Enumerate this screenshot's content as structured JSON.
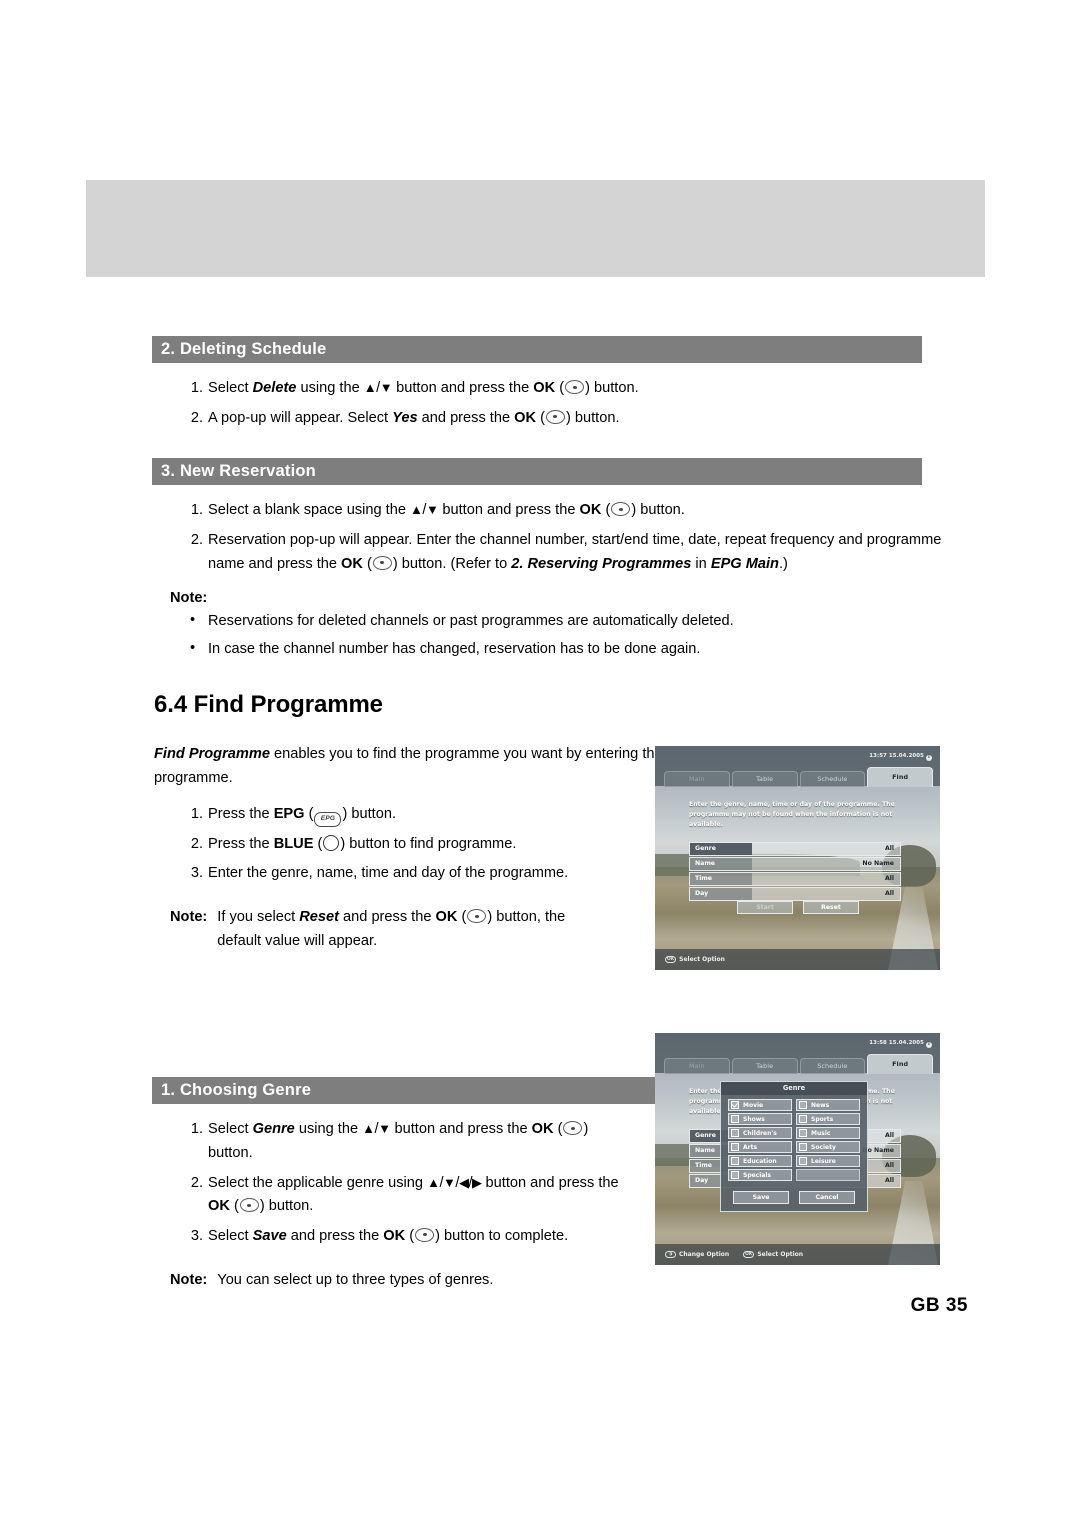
{
  "document": {
    "page_number_label": "GB 35"
  },
  "sections": [
    {
      "id": "deleting-schedule",
      "title": "2. Deleting Schedule",
      "steps": [
        {
          "num": "1.",
          "parts": [
            {
              "t": "Select ",
              "s": "plain"
            },
            {
              "t": "Delete",
              "s": "bi"
            },
            {
              "t": " using the ",
              "s": "plain"
            },
            {
              "t": "arrows-ud",
              "s": "glyph"
            },
            {
              "t": " button and press the ",
              "s": "plain"
            },
            {
              "t": "OK",
              "s": "bold"
            },
            {
              "t": " (",
              "s": "plain"
            },
            {
              "t": "ok-button",
              "s": "glyph"
            },
            {
              "t": ") button.",
              "s": "plain"
            }
          ]
        },
        {
          "num": "2.",
          "parts": [
            {
              "t": "A pop-up will appear. Select ",
              "s": "plain"
            },
            {
              "t": "Yes",
              "s": "bi"
            },
            {
              "t": " and press the ",
              "s": "plain"
            },
            {
              "t": "OK",
              "s": "bold"
            },
            {
              "t": " (",
              "s": "plain"
            },
            {
              "t": "ok-button",
              "s": "glyph"
            },
            {
              "t": ") button.",
              "s": "plain"
            }
          ]
        }
      ]
    },
    {
      "id": "new-reservation",
      "title": "3. New Reservation",
      "steps": [
        {
          "num": "1.",
          "parts": [
            {
              "t": "Select a blank space using the ",
              "s": "plain"
            },
            {
              "t": "arrows-ud",
              "s": "glyph"
            },
            {
              "t": " button and press the ",
              "s": "plain"
            },
            {
              "t": "OK",
              "s": "bold"
            },
            {
              "t": " (",
              "s": "plain"
            },
            {
              "t": "ok-button",
              "s": "glyph"
            },
            {
              "t": ") button.",
              "s": "plain"
            }
          ]
        },
        {
          "num": "2.",
          "parts": [
            {
              "t": "Reservation pop-up will appear. Enter the channel number, start/end time, date, repeat frequency and programme name and press the ",
              "s": "plain"
            },
            {
              "t": "OK",
              "s": "bold"
            },
            {
              "t": " (",
              "s": "plain"
            },
            {
              "t": "ok-button",
              "s": "glyph"
            },
            {
              "t": ") button. (Refer to ",
              "s": "plain"
            },
            {
              "t": "2. Reserving Programmes",
              "s": "bi"
            },
            {
              "t": " in ",
              "s": "plain"
            },
            {
              "t": "EPG Main",
              "s": "bi"
            },
            {
              "t": ".)",
              "s": "plain"
            }
          ]
        }
      ],
      "note_label": "Note:",
      "note_bullets": [
        "Reservations for deleted channels or past programmes are automatically deleted.",
        "In case the channel number has changed, reservation has to be done again."
      ]
    }
  ],
  "find_programme": {
    "heading": "6.4 Find Programme",
    "intro_parts": [
      {
        "t": "Find Programme",
        "s": "bi"
      },
      {
        "t": " enables you to find the programme you want by entering the genre, name, time and the day of the programme.",
        "s": "plain"
      }
    ],
    "steps": [
      {
        "num": "1.",
        "parts": [
          {
            "t": "Press the ",
            "s": "plain"
          },
          {
            "t": "EPG",
            "s": "bold"
          },
          {
            "t": " (",
            "s": "plain"
          },
          {
            "t": "epg-button",
            "s": "glyph"
          },
          {
            "t": ") button.",
            "s": "plain"
          }
        ]
      },
      {
        "num": "2.",
        "parts": [
          {
            "t": "Press the ",
            "s": "plain"
          },
          {
            "t": "BLUE",
            "s": "bold"
          },
          {
            "t": " (",
            "s": "plain"
          },
          {
            "t": "blue-button",
            "s": "glyph"
          },
          {
            "t": ") button to find programme.",
            "s": "plain"
          }
        ]
      },
      {
        "num": "3.",
        "parts": [
          {
            "t": "Enter the genre, name, time and day of the programme.",
            "s": "plain"
          }
        ]
      }
    ],
    "note_label": "Note:",
    "note_parts": [
      {
        "t": "If you select ",
        "s": "plain"
      },
      {
        "t": "Reset",
        "s": "bi"
      },
      {
        "t": " and press the ",
        "s": "plain"
      },
      {
        "t": "OK",
        "s": "bold"
      },
      {
        "t": " (",
        "s": "plain"
      },
      {
        "t": "ok-button",
        "s": "glyph"
      },
      {
        "t": ") button, the default value will appear.",
        "s": "plain"
      }
    ]
  },
  "choosing_genre": {
    "title": "1. Choosing Genre",
    "steps": [
      {
        "num": "1.",
        "parts": [
          {
            "t": "Select ",
            "s": "plain"
          },
          {
            "t": "Genre",
            "s": "bi"
          },
          {
            "t": " using the ",
            "s": "plain"
          },
          {
            "t": "arrows-ud",
            "s": "glyph"
          },
          {
            "t": " button and press the ",
            "s": "plain"
          },
          {
            "t": "OK",
            "s": "bold"
          },
          {
            "t": " (",
            "s": "plain"
          },
          {
            "t": "ok-button",
            "s": "glyph"
          },
          {
            "t": ") button.",
            "s": "plain"
          }
        ]
      },
      {
        "num": "2.",
        "parts": [
          {
            "t": "Select the applicable genre using ",
            "s": "plain"
          },
          {
            "t": "arrows-udlr",
            "s": "glyph"
          },
          {
            "t": " button and press the ",
            "s": "plain"
          },
          {
            "t": "OK",
            "s": "bold"
          },
          {
            "t": " (",
            "s": "plain"
          },
          {
            "t": "ok-button",
            "s": "glyph"
          },
          {
            "t": ") button.",
            "s": "plain"
          }
        ]
      },
      {
        "num": "3.",
        "parts": [
          {
            "t": "Select ",
            "s": "plain"
          },
          {
            "t": "Save",
            "s": "bi"
          },
          {
            "t": " and press the ",
            "s": "plain"
          },
          {
            "t": "OK",
            "s": "bold"
          },
          {
            "t": " (",
            "s": "plain"
          },
          {
            "t": "ok-button",
            "s": "glyph"
          },
          {
            "t": ") button to complete.",
            "s": "plain"
          }
        ]
      }
    ],
    "note_label": "Note:",
    "note_text": "You can select up to three types of genres."
  },
  "tv_find": {
    "clock": "13:57 15.04.2005",
    "info_glyph": "i",
    "tabs": [
      {
        "label": "Main",
        "active": false,
        "dim": true
      },
      {
        "label": "Table",
        "active": false,
        "dim": false
      },
      {
        "label": "Schedule",
        "active": false,
        "dim": false
      },
      {
        "label": "Find",
        "active": true,
        "dim": false
      }
    ],
    "description": "Enter the genre, name, time or day of the programme. The programme may not be found when the information is not available.",
    "rows": [
      {
        "label": "Genre",
        "value": "All",
        "selected": true
      },
      {
        "label": "Name",
        "value": "No Name",
        "selected": false
      },
      {
        "label": "Time",
        "value": "All",
        "selected": false
      },
      {
        "label": "Day",
        "value": "All",
        "selected": false
      }
    ],
    "buttons": [
      {
        "label": "Start",
        "ghost": true
      },
      {
        "label": "Reset",
        "ghost": false
      }
    ],
    "hints": [
      {
        "key": "OK",
        "label": "Select Option"
      }
    ]
  },
  "tv_genre": {
    "clock": "13:58 15.04.2005",
    "info_glyph": "i",
    "tabs": [
      {
        "label": "Main",
        "active": false,
        "dim": true
      },
      {
        "label": "Table",
        "active": false,
        "dim": false
      },
      {
        "label": "Schedule",
        "active": false,
        "dim": false
      },
      {
        "label": "Find",
        "active": true,
        "dim": false
      }
    ],
    "description": "Enter the genre, name, time or day of the programme. The programme may not be found when the information is not available.",
    "rows": [
      {
        "label": "Genre",
        "value": "All",
        "selected": true
      },
      {
        "label": "Name",
        "value": "No Name",
        "selected": false
      },
      {
        "label": "Time",
        "value": "All",
        "selected": false
      },
      {
        "label": "Day",
        "value": "All",
        "selected": false
      }
    ],
    "dialog": {
      "title": "Genre",
      "options": [
        {
          "label": "Movie",
          "checked": true
        },
        {
          "label": "News",
          "checked": false
        },
        {
          "label": "Shows",
          "checked": false
        },
        {
          "label": "Sports",
          "checked": false
        },
        {
          "label": "Children's",
          "checked": false
        },
        {
          "label": "Music",
          "checked": false
        },
        {
          "label": "Arts",
          "checked": false
        },
        {
          "label": "Society",
          "checked": false
        },
        {
          "label": "Education",
          "checked": false
        },
        {
          "label": "Leisure",
          "checked": false
        },
        {
          "label": "Specials",
          "checked": false
        },
        {
          "label": "",
          "checked": false
        }
      ],
      "buttons": [
        {
          "label": "Save"
        },
        {
          "label": "Cancel"
        }
      ]
    },
    "hints": [
      {
        "key": "◑",
        "label": "Change Option"
      },
      {
        "key": "OK",
        "label": "Select Option"
      }
    ]
  }
}
